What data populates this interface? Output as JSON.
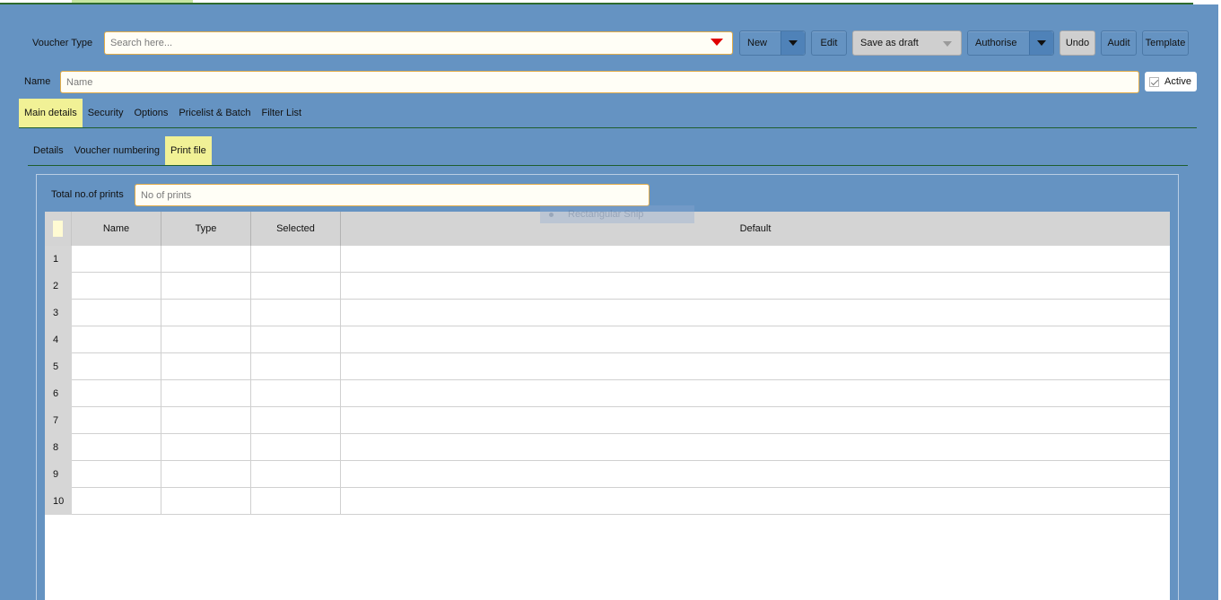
{
  "toolbar": {
    "voucher_type_label": "Voucher Type",
    "search_placeholder": "Search here...",
    "new_label": "New",
    "edit_label": "Edit",
    "save_draft_label": "Save as draft",
    "authorise_label": "Authorise",
    "undo_label": "Undo",
    "audit_label": "Audit",
    "template_label": "Template"
  },
  "name_row": {
    "label": "Name",
    "placeholder": "Name",
    "active_label": "Active",
    "active_checked": true
  },
  "tabs": [
    {
      "label": "Main details",
      "selected": true
    },
    {
      "label": "Security",
      "selected": false
    },
    {
      "label": "Options",
      "selected": false
    },
    {
      "label": "Pricelist & Batch",
      "selected": false
    },
    {
      "label": "Filter List",
      "selected": false
    }
  ],
  "subtabs": [
    {
      "label": "Details",
      "selected": false
    },
    {
      "label": "Voucher numbering",
      "selected": false
    },
    {
      "label": "Print file",
      "selected": true
    }
  ],
  "print_file": {
    "total_prints_label": "Total no.of prints",
    "total_prints_placeholder": "No of prints"
  },
  "grid": {
    "columns": [
      "Name",
      "Type",
      "Selected",
      "Default"
    ],
    "rows": [
      "1",
      "2",
      "3",
      "4",
      "5",
      "6",
      "7",
      "8",
      "9",
      "10"
    ]
  },
  "overlay": {
    "snip_label": "Rectangular Snip"
  },
  "colors": {
    "background": "#6593c2",
    "tab_selected": "#f1f196",
    "input_border": "#e2ad4a",
    "dropdown_arrow": "#e00000"
  }
}
